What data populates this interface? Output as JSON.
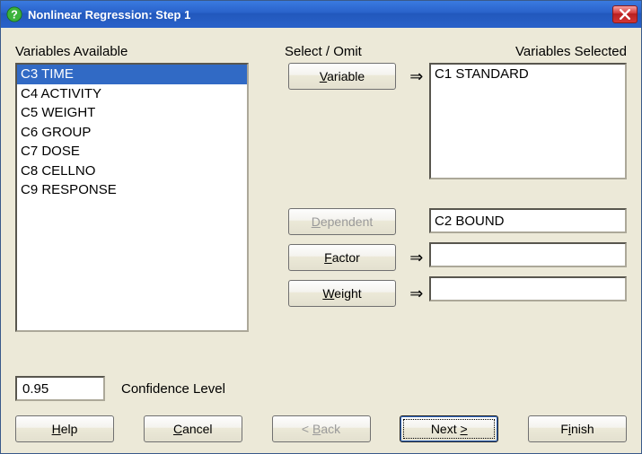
{
  "window": {
    "title": "Nonlinear Regression: Step 1"
  },
  "labels": {
    "variables_available": "Variables Available",
    "select_omit": "Select / Omit",
    "variables_selected": "Variables Selected",
    "confidence_level": "Confidence Level"
  },
  "available_list": {
    "items": [
      "C3 TIME",
      "C4 ACTIVITY",
      "C5 WEIGHT",
      "C6 GROUP",
      "C7 DOSE",
      "C8 CELLNO",
      "C9 RESPONSE"
    ],
    "selected_index": 0
  },
  "select_buttons": {
    "variable": {
      "prefix": "V",
      "rest": "ariable"
    },
    "dependent": {
      "prefix": "D",
      "rest": "ependent"
    },
    "factor": {
      "prefix": "F",
      "rest": "actor"
    },
    "weight": {
      "prefix": "W",
      "rest": "eight"
    }
  },
  "arrows": {
    "glyph": "⇒"
  },
  "selected_variable_list": {
    "items": [
      "C1 STANDARD"
    ]
  },
  "fields": {
    "dependent": "C2 BOUND",
    "factor": "",
    "weight": ""
  },
  "confidence": {
    "value": "0.95"
  },
  "footer": {
    "help": {
      "prefix": "H",
      "rest": "elp"
    },
    "cancel": {
      "prefix": "C",
      "rest": "ancel"
    },
    "back": {
      "prefix": "< ",
      "acc": "B",
      "rest": "ack"
    },
    "next": {
      "prefix": "Next ",
      "acc": ">",
      "rest": ""
    },
    "finish": {
      "prefix": "F",
      "acc": "i",
      "rest": "nish"
    }
  }
}
